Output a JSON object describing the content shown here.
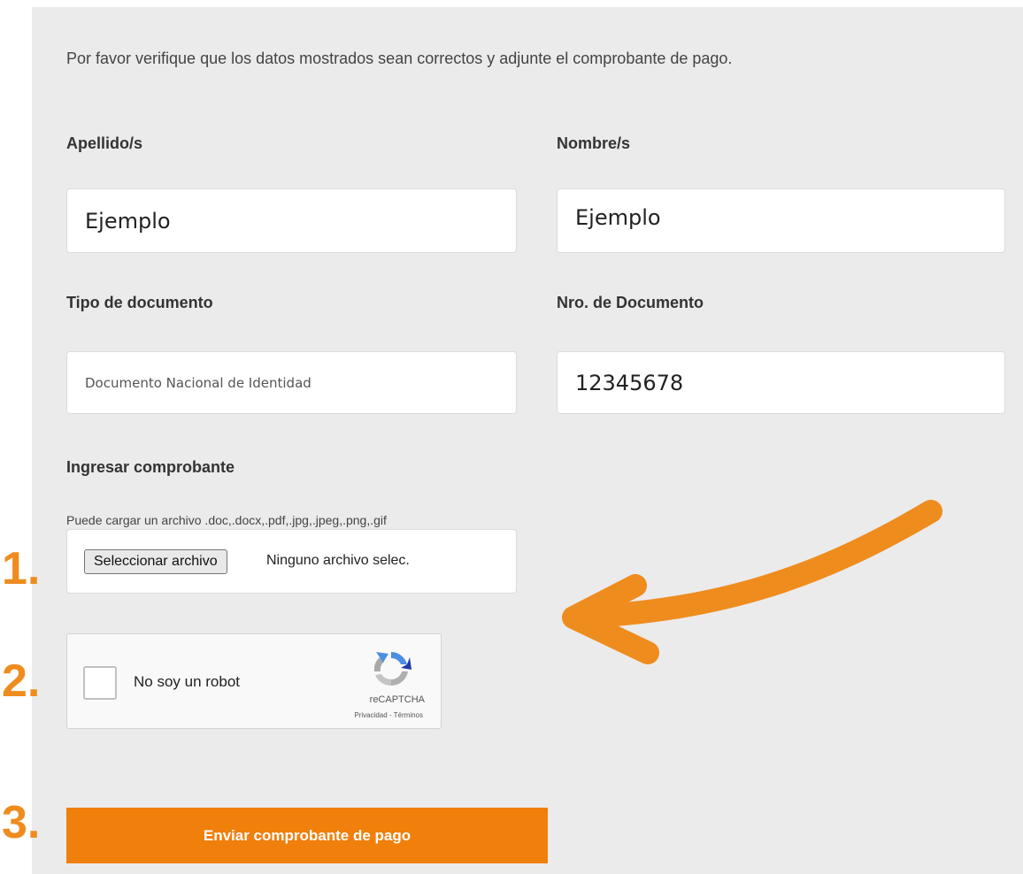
{
  "form": {
    "intro": "Por favor verifique que los datos mostrados sean correctos y adjunte el comprobante de pago.",
    "surname_label": "Apellido/s",
    "surname_value": "Ejemplo",
    "name_label": "Nombre/s",
    "name_value": "Ejemplo",
    "doc_type_label": "Tipo de documento",
    "doc_type_value": "Documento Nacional de Identidad",
    "doc_number_label": "Nro. de Documento",
    "doc_number_value": "12345678",
    "upload_label": "Ingresar comprobante",
    "upload_hint": "Puede cargar un archivo .doc,.docx,.pdf,.jpg,.jpeg,.png,.gif",
    "file_button": "Seleccionar archivo",
    "file_status": "Ninguno archivo selec."
  },
  "recaptcha": {
    "label": "No soy un robot",
    "brand": "reCAPTCHA",
    "links": "Privacidad - Términos"
  },
  "submit_label": "Enviar comprobante de pago",
  "steps": [
    "1.",
    "2.",
    "3."
  ],
  "colors": {
    "accent": "#f07f0c",
    "step_number": "#ef8c1e",
    "panel_bg": "#ebebeb"
  },
  "icons": {
    "recaptcha": "recaptcha-logo-icon",
    "arrow": "curved-arrow-icon"
  }
}
